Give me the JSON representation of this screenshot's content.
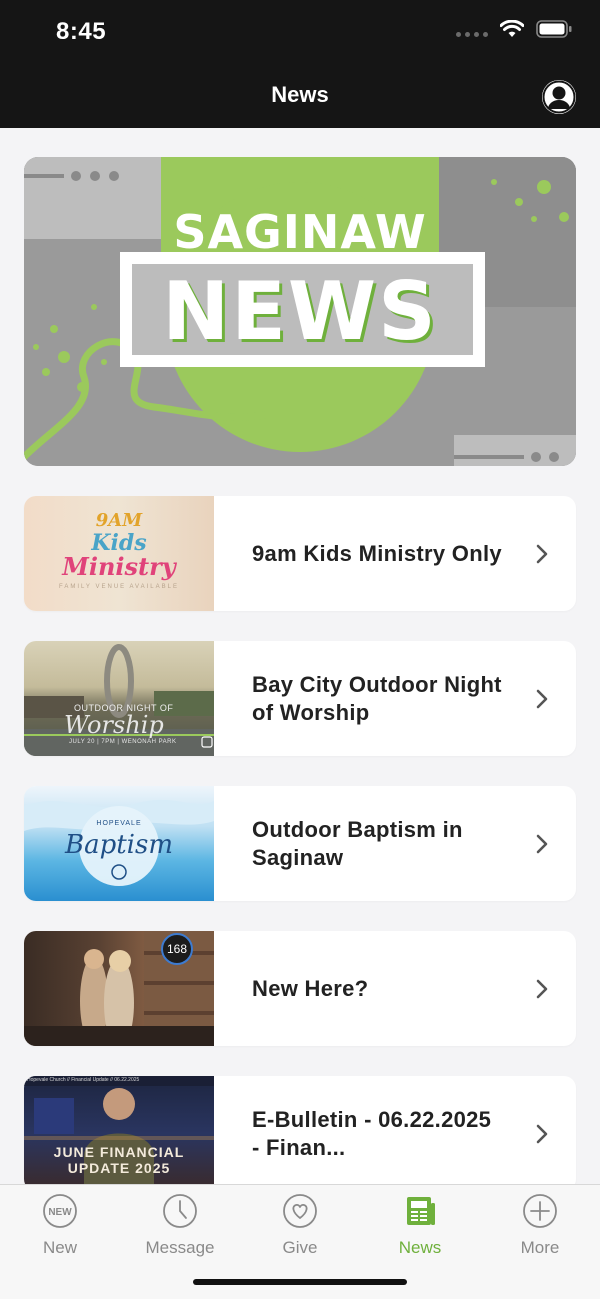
{
  "status_bar": {
    "time": "8:45"
  },
  "header": {
    "title": "News"
  },
  "hero": {
    "line1": "SAGINAW",
    "line2": "NEWS"
  },
  "thumbs": {
    "kids": {
      "line1": "9AM",
      "line2": "Kids",
      "line3": "Ministry",
      "sub": "FAMILY VENUE AVAILABLE"
    },
    "outdoor": {
      "line1": "OUTDOOR NIGHT OF",
      "line2": "Worship",
      "sub": "JULY 20 | 7PM | WENONAH PARK"
    },
    "baptism": {
      "line1": "HOPEVALE",
      "line2": "Baptism"
    },
    "newhere": {
      "badge": "168"
    },
    "bulletin": {
      "top": "Hopevale Church // Financial Update // 06.22.2025",
      "line1": "JUNE FINANCIAL",
      "line2": "UPDATE 2025"
    }
  },
  "news_items": [
    {
      "title": "9am Kids Ministry Only"
    },
    {
      "title": "Bay City Outdoor Night of Worship"
    },
    {
      "title": "Outdoor Baptism in Saginaw"
    },
    {
      "title": "New Here?"
    },
    {
      "title": "E-Bulletin - 06.22.2025 - Finan..."
    }
  ],
  "tabs": [
    {
      "label": "New",
      "icon": "new-badge-icon",
      "active": false
    },
    {
      "label": "Message",
      "icon": "clock-icon",
      "active": false
    },
    {
      "label": "Give",
      "icon": "heart-icon",
      "active": false
    },
    {
      "label": "News",
      "icon": "newspaper-icon",
      "active": true
    },
    {
      "label": "More",
      "icon": "plus-icon",
      "active": false
    }
  ],
  "new_icon_text": "NEW",
  "colors": {
    "accent": "#6fb03c",
    "hero_green": "#9bc95c",
    "header_bg": "#151515"
  }
}
